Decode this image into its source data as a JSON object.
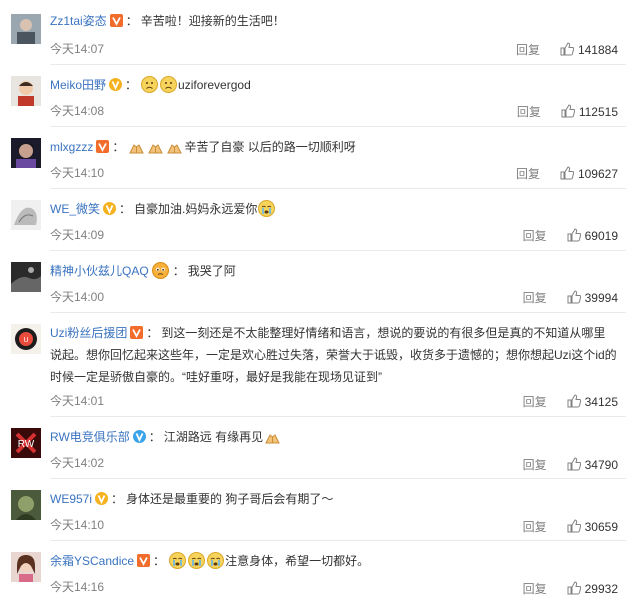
{
  "comments": [
    {
      "user": "Zz1tai姿态",
      "badge": "red",
      "text": "辛苦啦！迎接新的生活吧！",
      "emojis": [],
      "emojis_after": [],
      "time": "今天14:07",
      "reply": "回复",
      "likes": "141884"
    },
    {
      "user": "Meiko田野",
      "badge": "yellow",
      "text": "uziforevergod",
      "emojis": [
        "sad-face",
        "sad-face"
      ],
      "emojis_after": [],
      "time": "今天14:08",
      "reply": "回复",
      "likes": "112515"
    },
    {
      "user": "mlxgzzz",
      "badge": "red",
      "text": "辛苦了自豪 以后的路一切顺利呀",
      "emojis": [
        "praying-hands",
        "praying-hands",
        "praying-hands"
      ],
      "emojis_after": [],
      "time": "今天14:10",
      "reply": "回复",
      "likes": "109627"
    },
    {
      "user": "WE_微笑",
      "badge": "yellow",
      "text": "自豪加油.妈妈永远爱你",
      "emojis": [],
      "emojis_after": [
        "crying-face"
      ],
      "time": "今天14:09",
      "reply": "回复",
      "likes": "69019"
    },
    {
      "user": "精神小伙兹儿QAQ",
      "badge": "",
      "text": "我哭了阿",
      "emojis": [
        "teary-face"
      ],
      "emojis_after": [],
      "time": "今天14:00",
      "reply": "回复",
      "likes": "39994"
    },
    {
      "user": "Uzi粉丝后援团",
      "badge": "red",
      "text": "到这一刻还是不太能整理好情绪和语言，想说的要说的有很多但是真的不知道从哪里 说起。想你回忆起来这些年，一定是欢心胜过失落，荣誉大于诋毁，收货多于遗憾的；想你想起Uzi这个id的时候一定是骄傲自豪的。“哇好重呀，最好是我能在现场见证到”",
      "emojis": [],
      "emojis_after": [],
      "time": "今天14:01",
      "reply": "回复",
      "likes": "34125"
    },
    {
      "user": "RW电竞俱乐部",
      "badge": "blue",
      "text": "江湖路远 有缘再见",
      "emojis": [],
      "emojis_after": [
        "praying-hands"
      ],
      "time": "今天14:02",
      "reply": "回复",
      "likes": "34790"
    },
    {
      "user": "WE957i",
      "badge": "yellow",
      "text": "身体还是最重要的 狗子哥后会有期了～",
      "emojis": [],
      "emojis_after": [],
      "time": "今天14:10",
      "reply": "回复",
      "likes": "30659"
    },
    {
      "user": "余霜YSCandice",
      "badge": "red",
      "text": "注意身体，希望一切都好。",
      "emojis": [
        "crying-face",
        "crying-face",
        "crying-face"
      ],
      "emojis_after": [],
      "time": "今天14:16",
      "reply": "回复",
      "likes": "29932"
    }
  ],
  "colors": {
    "username": "#eb7350",
    "username_blue": "#3a73c0",
    "time": "#808080",
    "divider": "#eaeaea",
    "badge_red": "#f26c2b",
    "badge_yellow": "#f5b11e",
    "badge_blue": "#3aa3ea"
  }
}
